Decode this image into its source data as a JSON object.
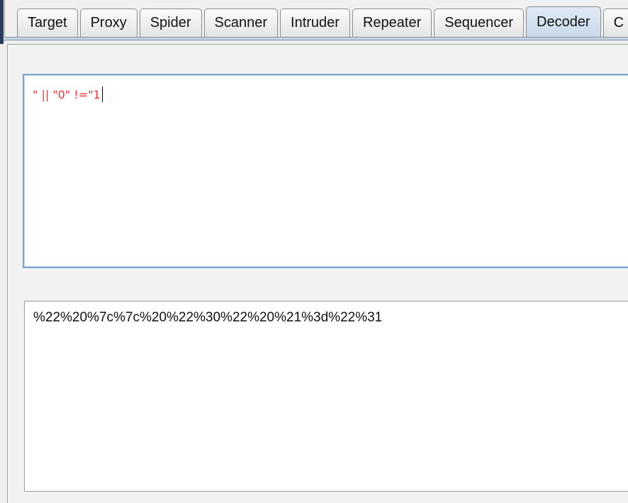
{
  "tabs": [
    {
      "label": "Target",
      "active": false
    },
    {
      "label": "Proxy",
      "active": false
    },
    {
      "label": "Spider",
      "active": false
    },
    {
      "label": "Scanner",
      "active": false
    },
    {
      "label": "Intruder",
      "active": false
    },
    {
      "label": "Repeater",
      "active": false
    },
    {
      "label": "Sequencer",
      "active": false
    },
    {
      "label": "Decoder",
      "active": true
    },
    {
      "label": "C",
      "active": false
    }
  ],
  "decoder": {
    "input_text": "\" || \"0\" !=\"1",
    "input_color": "#e8323c",
    "output_text": "%22%20%7c%7c%20%22%30%22%20%21%3d%22%31"
  }
}
